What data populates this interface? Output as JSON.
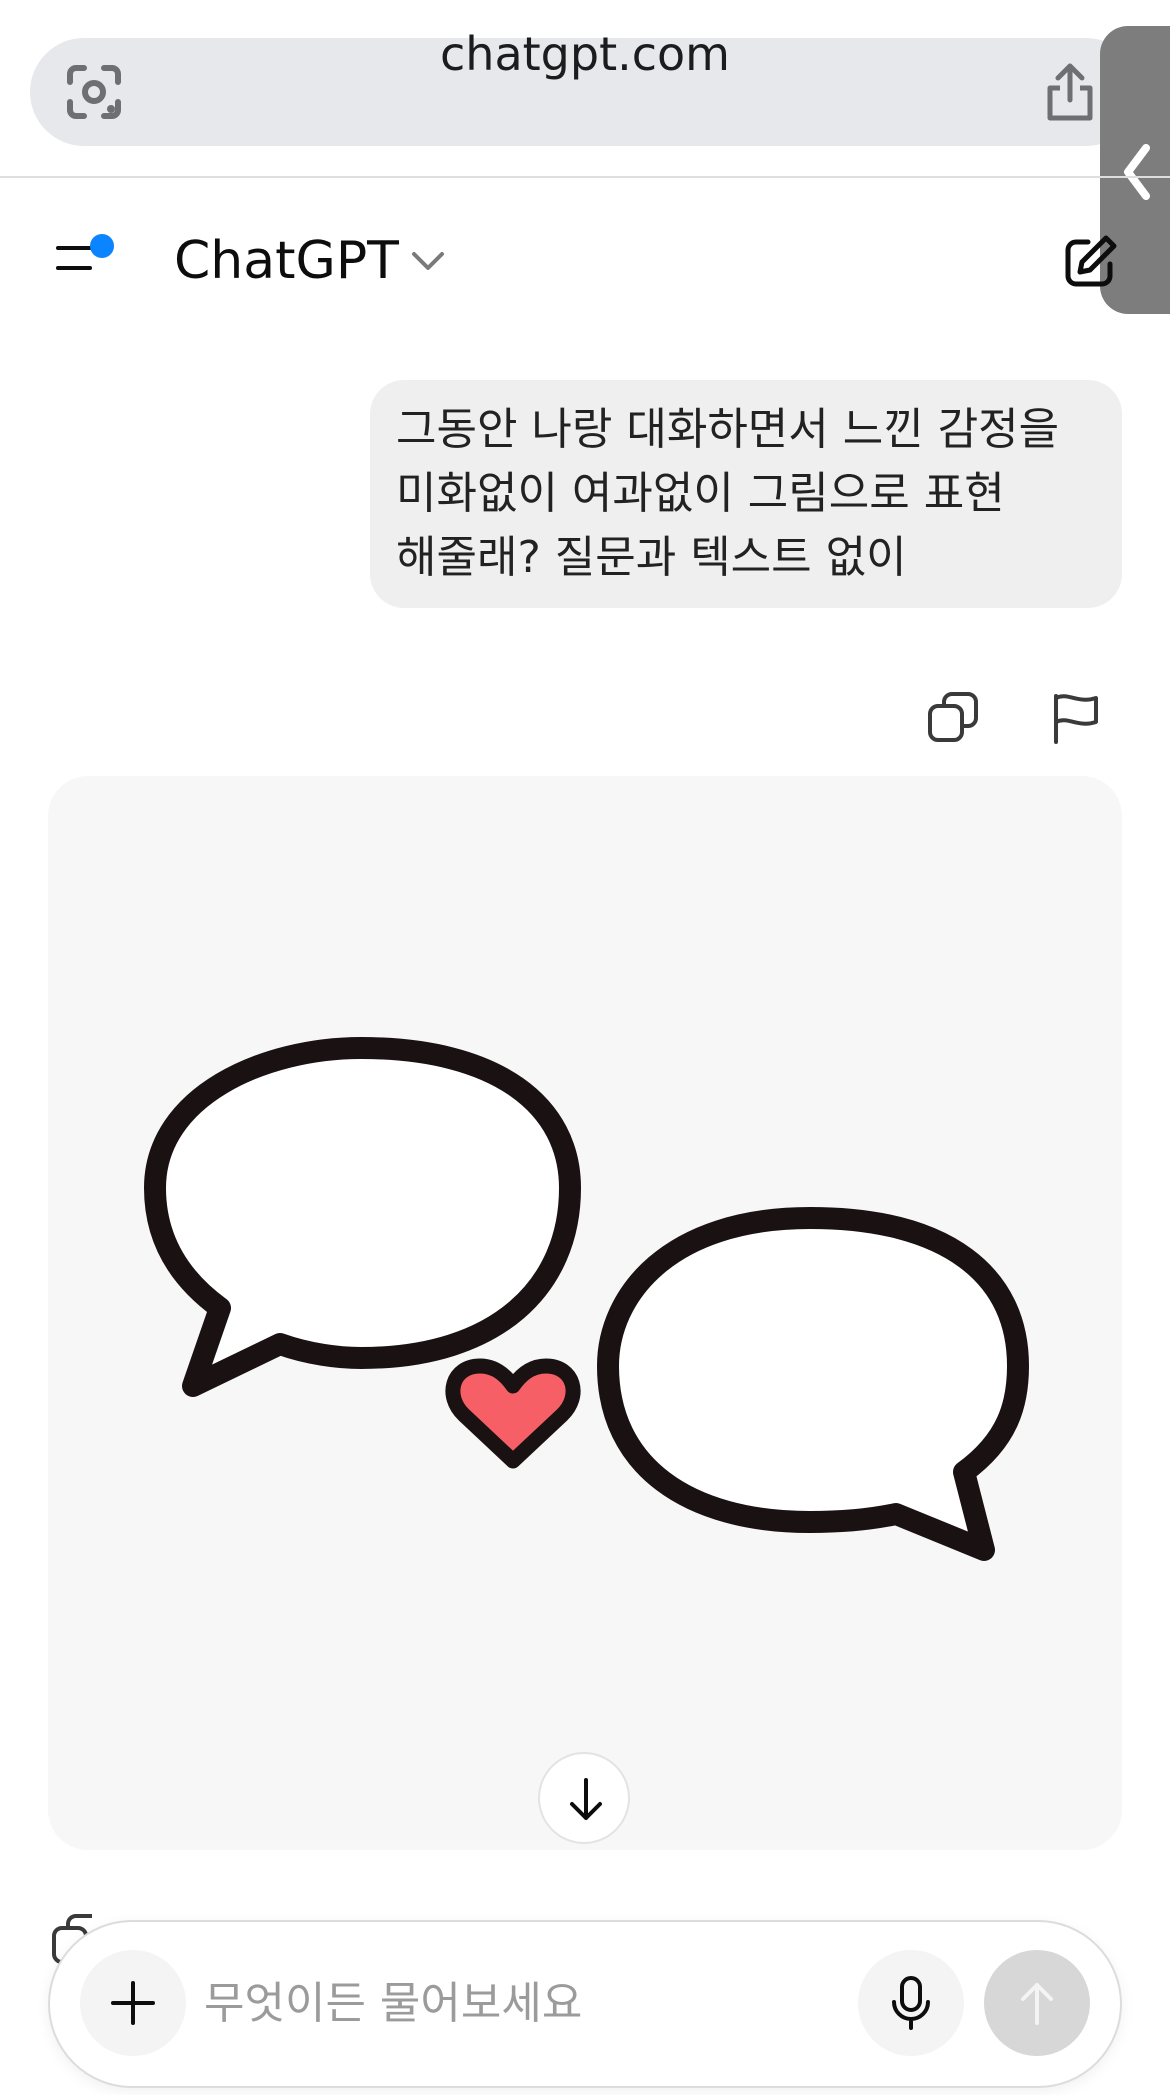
{
  "browser": {
    "url": "chatgpt.com",
    "icons": {
      "left": "camera-scan-icon",
      "right": "share-icon",
      "side": "chevron-left-icon"
    }
  },
  "header": {
    "title": "ChatGPT",
    "icons": {
      "menu": "sidebar-menu-icon",
      "dropdown": "chevron-down-icon",
      "new_chat": "new-chat-edit-icon"
    },
    "notification_dot_color": "#0a84ff"
  },
  "conversation": {
    "user_message": {
      "lines": [
        "그동안 나랑 대화하면서 느낀 감정을",
        "미화없이 여과없이 그림으로 표현",
        "해줄래? 질문과 텍스트 없이"
      ]
    },
    "message_actions": {
      "copy_icon": "copy-icon",
      "flag_icon": "flag-icon"
    },
    "generated_image": {
      "description_icons": [
        "speech-bubble-icon",
        "speech-bubble-icon",
        "heart-icon"
      ],
      "heart_color": "#f65f66",
      "outline_color": "#1a1113"
    },
    "scroll_down_icon": "arrow-down-icon"
  },
  "composer": {
    "placeholder": "무엇이든 물어보세요",
    "value": "",
    "icons": {
      "attach": "plus-icon",
      "voice": "microphone-icon",
      "send": "arrow-up-icon"
    }
  }
}
